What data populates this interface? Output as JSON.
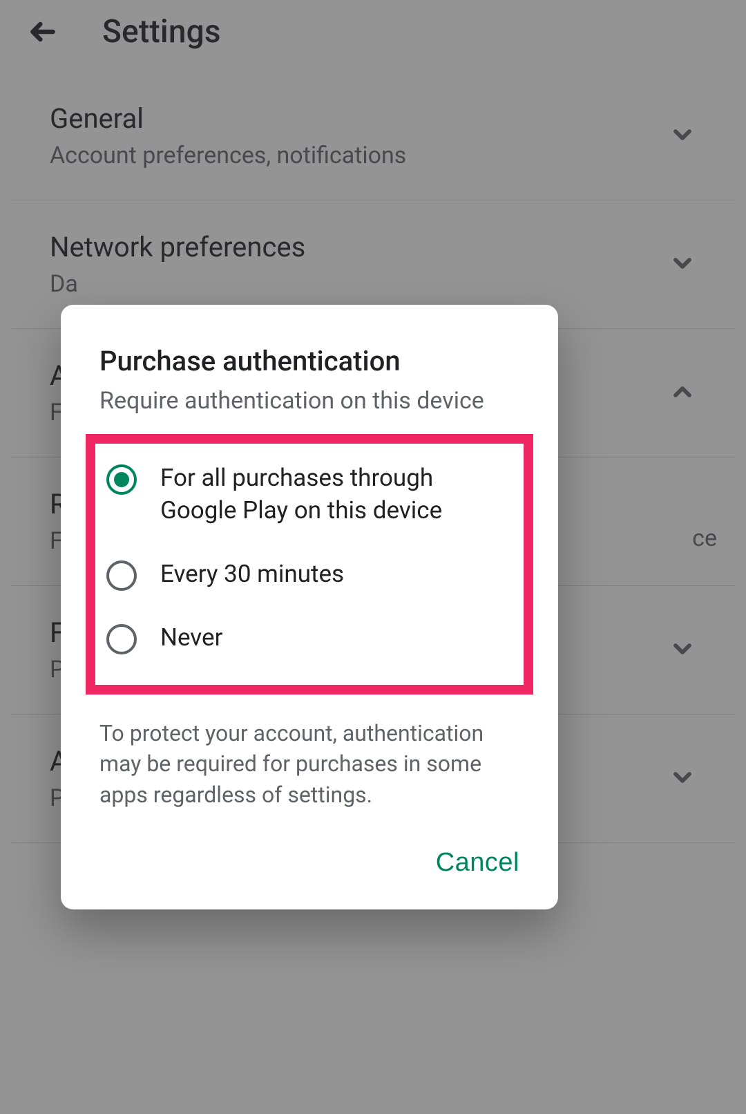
{
  "header": {
    "title": "Settings"
  },
  "sections": [
    {
      "title": "General",
      "subtitle": "Account preferences, notifications",
      "expand": "down"
    },
    {
      "title": "Network preferences",
      "subtitle": "Da",
      "expand": "down"
    },
    {
      "title": "Au",
      "subtitle": "Fi",
      "expand": "up"
    },
    {
      "title": "Re",
      "subtitle": "Fo",
      "expand": "down",
      "tail": "ce"
    },
    {
      "title": "Fa",
      "subtitle": "Pa",
      "expand": "down"
    },
    {
      "title": "A",
      "subtitle": "Pl",
      "expand": "down"
    }
  ],
  "dialog": {
    "title": "Purchase authentication",
    "subtitle": "Require authentication on this device",
    "options": [
      {
        "label": "For all purchases through Google Play on this device",
        "selected": true
      },
      {
        "label": "Every 30 minutes",
        "selected": false
      },
      {
        "label": "Never",
        "selected": false
      }
    ],
    "note": "To protect your account, authentication may be required for purchases in some apps regardless of settings.",
    "cancel": "Cancel"
  }
}
